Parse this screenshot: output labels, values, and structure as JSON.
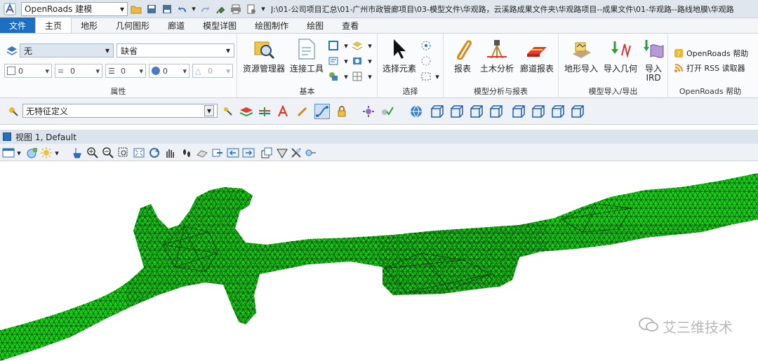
{
  "quick_access": {
    "workspace": "OpenRoads 建模",
    "path": "J:\\01-公司项目汇总\\01-广州市政管廊项目\\03-模型文件\\华观路，云溪路成果文件夹\\华观路项目--成果文件\\01-华观路--路线地膜\\华观路"
  },
  "tabs": [
    "文件",
    "主页",
    "地形",
    "几何图形",
    "廊道",
    "模型详图",
    "绘图制作",
    "绘图",
    "查看"
  ],
  "ribbon": {
    "attributes": {
      "level": "无",
      "style": "缺省",
      "color": "0",
      "line_style": "0",
      "weight": "0",
      "transparency": "0",
      "priority": "0",
      "label": "属性"
    },
    "basic": {
      "resource_manager": "资源管理器",
      "connect_tools": "连接工具",
      "label": "基本"
    },
    "select": {
      "select_element": "选择元素",
      "label": "选择"
    },
    "model_analysis": {
      "report": "报表",
      "civil_analysis": "土木分析",
      "corridor_report": "廊道报表",
      "label": "模型分析与报表"
    },
    "import": {
      "terrain_import": "地形导入",
      "import_geometry": "导入几何",
      "import_ird_line1": "导入",
      "import_ird_line2": "IRD",
      "label": "模型导入/导出"
    },
    "help": {
      "openroads_help": "OpenRoads 帮助",
      "rss": "打开 RSS 读取器",
      "label": "OpenRoads 帮助"
    }
  },
  "feature_bar": {
    "feature": "无特征定义"
  },
  "view": {
    "title": "视图 1, Default"
  },
  "watermark": "艾三维技术",
  "colors": {
    "mesh_fill": "#19d219",
    "mesh_line": "#0b3d0b",
    "accent": "#1e6fc2"
  }
}
